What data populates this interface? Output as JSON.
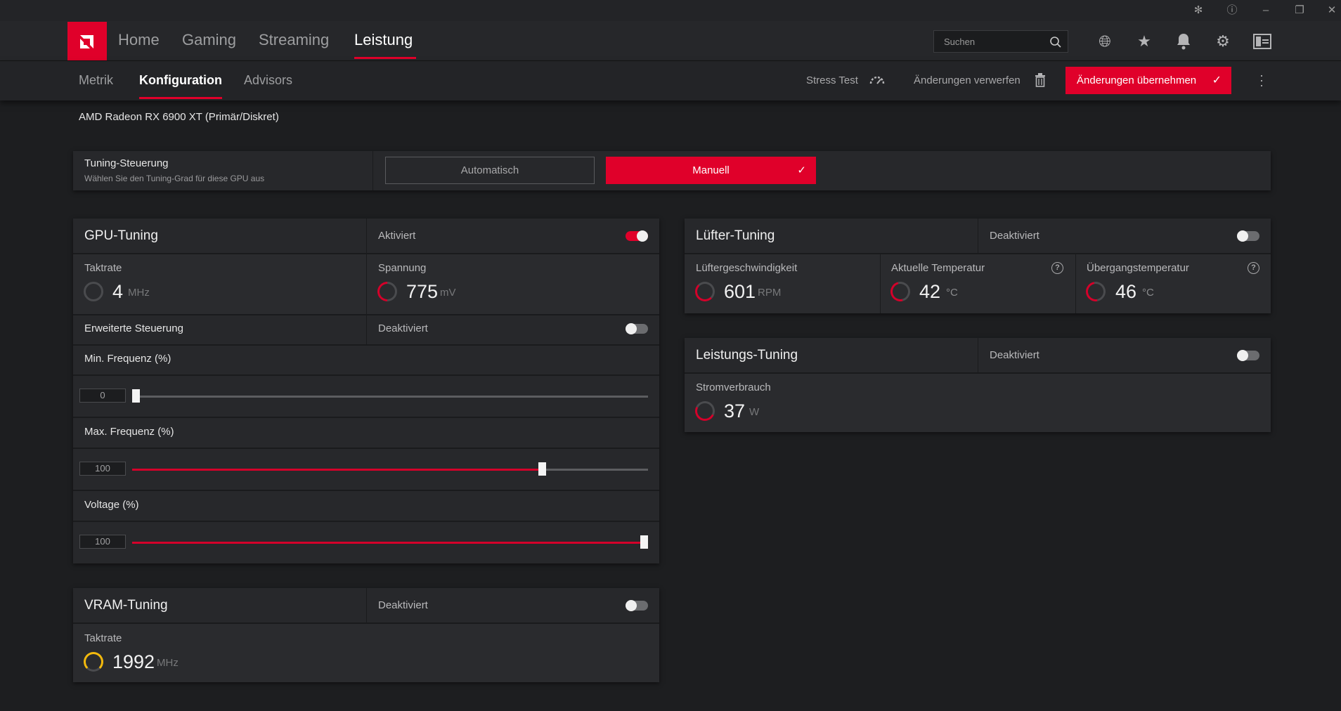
{
  "titlebar": {
    "icons": [
      "bug-icon",
      "help-icon",
      "minimize-icon",
      "restore-icon",
      "close-icon"
    ]
  },
  "nav": {
    "tabs": [
      {
        "label": "Home"
      },
      {
        "label": "Gaming"
      },
      {
        "label": "Streaming"
      },
      {
        "label": "Leistung"
      }
    ],
    "active_tab": "Leistung",
    "search_placeholder": "Suchen"
  },
  "subnav": {
    "tabs": [
      {
        "label": "Metrik"
      },
      {
        "label": "Konfiguration"
      },
      {
        "label": "Advisors"
      }
    ],
    "active_tab": "Konfiguration",
    "stress_test": "Stress Test",
    "discard": "Änderungen verwerfen",
    "apply": "Änderungen übernehmen"
  },
  "gpu_name": "AMD Radeon RX 6900 XT (Primär/Diskret)",
  "tuning_control": {
    "title": "Tuning-Steuerung",
    "subtitle": "Wählen Sie den Tuning-Grad für diese GPU aus",
    "option_auto": "Automatisch",
    "option_manual": "Manuell",
    "selected": "Manuell"
  },
  "gpu_tuning": {
    "title": "GPU-Tuning",
    "status": "Aktiviert",
    "enabled": true,
    "clock_label": "Taktrate",
    "clock_value": "4",
    "clock_unit": "MHz",
    "voltage_label": "Spannung",
    "voltage_value": "775",
    "voltage_unit": "mV",
    "advanced_label": "Erweiterte Steuerung",
    "advanced_status": "Deaktiviert",
    "advanced_enabled": false,
    "sliders": [
      {
        "label": "Min. Frequenz (%)",
        "value": "0",
        "fraction": 0.0
      },
      {
        "label": "Max. Frequenz (%)",
        "value": "100",
        "fraction": 0.8
      },
      {
        "label": "Voltage (%)",
        "value": "100",
        "fraction": 1.0
      }
    ]
  },
  "vram_tuning": {
    "title": "VRAM-Tuning",
    "status": "Deaktiviert",
    "enabled": false,
    "clock_label": "Taktrate",
    "clock_value": "1992",
    "clock_unit": "MHz"
  },
  "fan_tuning": {
    "title": "Lüfter-Tuning",
    "status": "Deaktiviert",
    "enabled": false,
    "speed_label": "Lüftergeschwindigkeit",
    "speed_value": "601",
    "speed_unit": "RPM",
    "temp_label": "Aktuelle Temperatur",
    "temp_value": "42",
    "temp_unit": "°C",
    "junction_label": "Übergangstemperatur",
    "junction_value": "46",
    "junction_unit": "°C"
  },
  "power_tuning": {
    "title": "Leistungs-Tuning",
    "status": "Deaktiviert",
    "enabled": false,
    "power_label": "Stromverbrauch",
    "power_value": "37",
    "power_unit": "W"
  },
  "colors": {
    "accent": "#e0002a",
    "background": "#1d1e20",
    "card": "#27282b",
    "gauge_yellow": "#f2b90d"
  }
}
